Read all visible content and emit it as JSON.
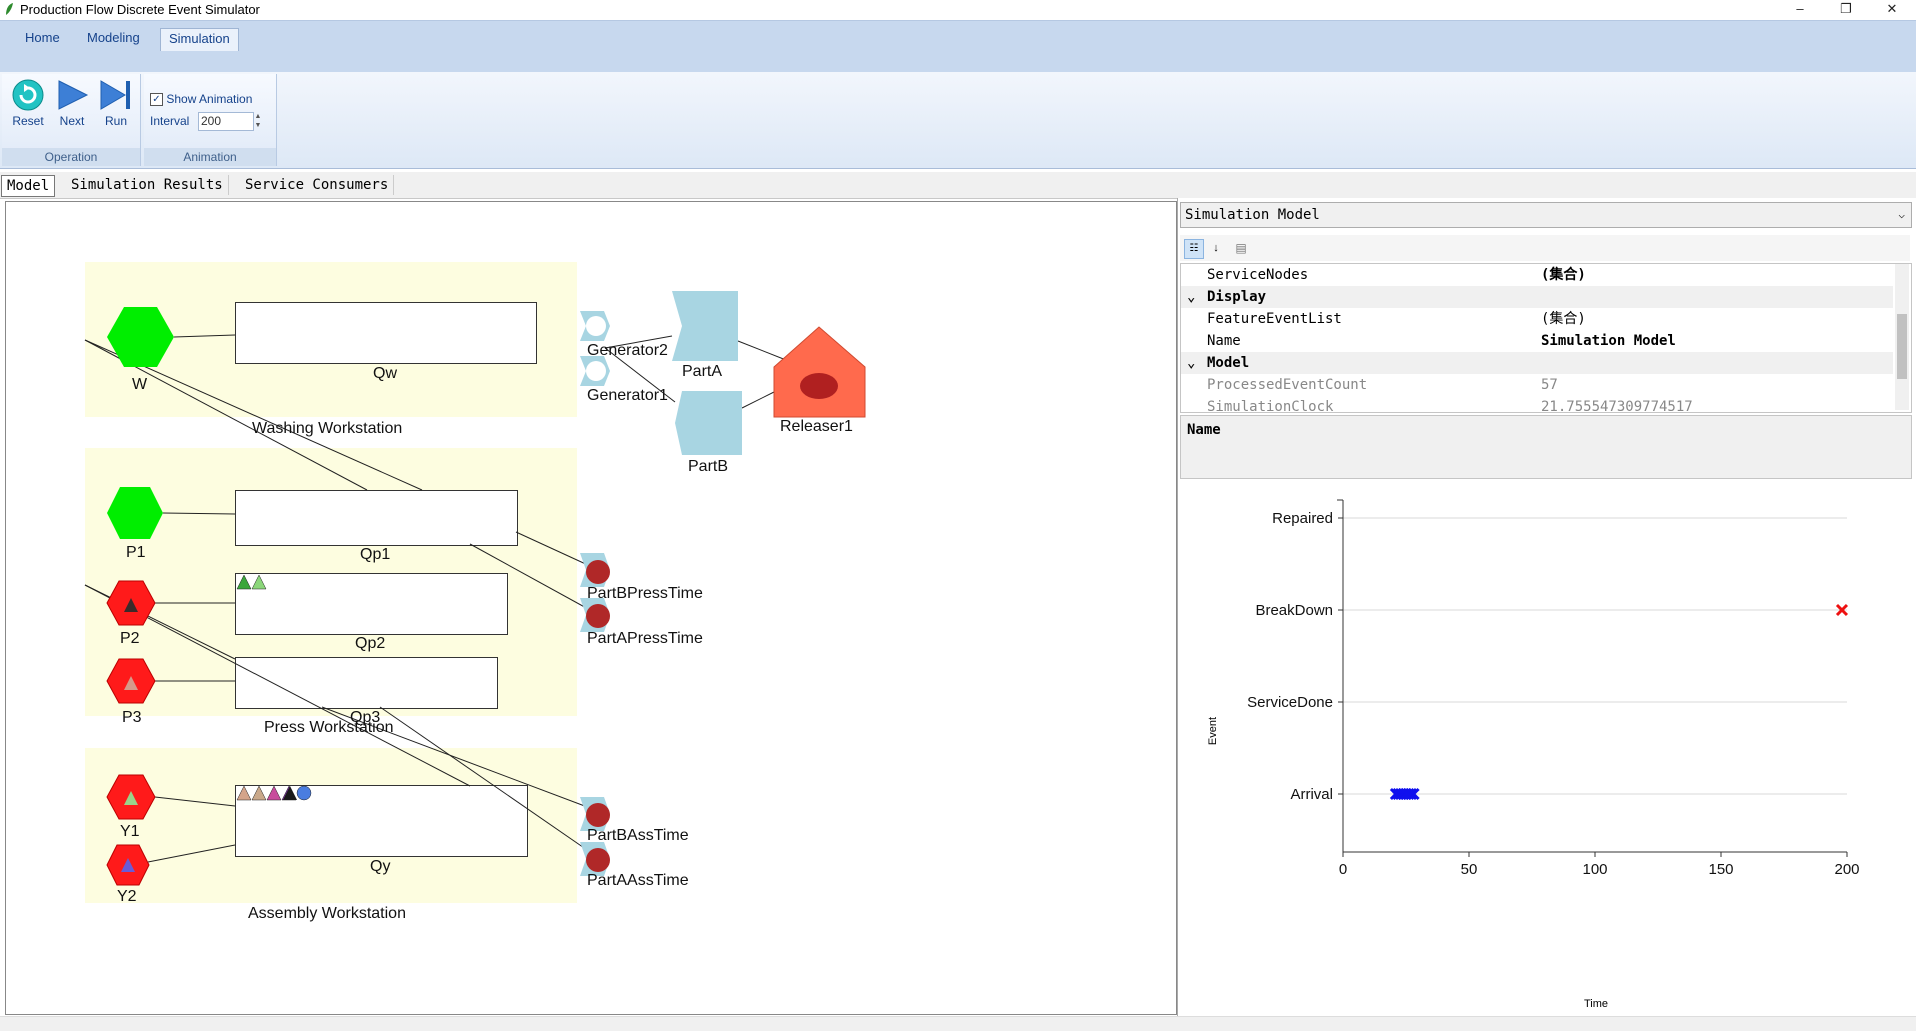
{
  "window": {
    "title": "Production Flow Discrete Event Simulator",
    "minimize": "–",
    "restore": "❐",
    "close": "✕"
  },
  "ribbon": {
    "tabs": [
      "Home",
      "Modeling",
      "Simulation"
    ],
    "active_tab": "Simulation",
    "operation": {
      "caption": "Operation",
      "reset": "Reset",
      "next": "Next",
      "run": "Run"
    },
    "animation": {
      "caption": "Animation",
      "show_animation": "Show Animation",
      "show_animation_checked": true,
      "interval_label": "Interval",
      "interval_value": "200"
    }
  },
  "doc_tabs": [
    "Model",
    "Simulation Results",
    "Service Consumers"
  ],
  "model": {
    "zones": {
      "washing": "Washing Workstation",
      "press": "Press Workstation",
      "assembly": "Assembly Workstation"
    },
    "servers": {
      "w": "W",
      "p1": "P1",
      "p2": "P2",
      "p3": "P3",
      "y1": "Y1",
      "y2": "Y2"
    },
    "queues": {
      "qw": "Qw",
      "qp1": "Qp1",
      "qp2": "Qp2",
      "qp3": "Qp3",
      "qy": "Qy"
    },
    "generators": {
      "g1": "Generator1",
      "g2": "Generator2"
    },
    "parts": {
      "a": "PartA",
      "b": "PartB"
    },
    "releaser": "Releaser1",
    "timers": {
      "pb_press": "PartBPressTime",
      "pa_press": "PartAPressTime",
      "pb_ass": "PartBAssTime",
      "pa_ass": "PartAAssTime"
    },
    "colors": {
      "server_idle": "#00ee00",
      "server_busy": "#ff1a1a",
      "zone": "#fdfde0",
      "node": "#a8d5e2",
      "releaser": "#ff6a4d"
    }
  },
  "property_grid": {
    "selected_object": "Simulation Model",
    "rows": [
      {
        "name": "ServiceNodes",
        "value": "(集合)",
        "kind": "prop"
      },
      {
        "name": "Display",
        "value": "",
        "kind": "category"
      },
      {
        "name": "FeatureEventList",
        "value": "(集合)",
        "kind": "prop"
      },
      {
        "name": "Name",
        "value": "Simulation Model",
        "kind": "prop-bold"
      },
      {
        "name": "Model",
        "value": "",
        "kind": "category"
      },
      {
        "name": "ProcessedEventCount",
        "value": "57",
        "kind": "prop-dim"
      },
      {
        "name": "SimulationClock",
        "value": "21.755547309774517",
        "kind": "prop-dim"
      }
    ],
    "description_title": "Name"
  },
  "chart_data": {
    "type": "scatter",
    "title": "",
    "xlabel": "Time",
    "ylabel": "Event",
    "xlim": [
      0,
      200
    ],
    "xticks": [
      0,
      50,
      100,
      150,
      200
    ],
    "categories": [
      "Arrival",
      "ServiceDone",
      "BreakDown",
      "Repaired"
    ],
    "grid": true,
    "series": [
      {
        "values_x": [
          21,
          22,
          23,
          24,
          25,
          26,
          27,
          28
        ],
        "values_y": [
          "Arrival",
          "Arrival",
          "Arrival",
          "Arrival",
          "Arrival",
          "Arrival",
          "Arrival",
          "Arrival"
        ],
        "color": "#1010ee"
      },
      {
        "values_x": [
          198
        ],
        "values_y": [
          "BreakDown"
        ],
        "color": "#ee1010"
      }
    ]
  }
}
